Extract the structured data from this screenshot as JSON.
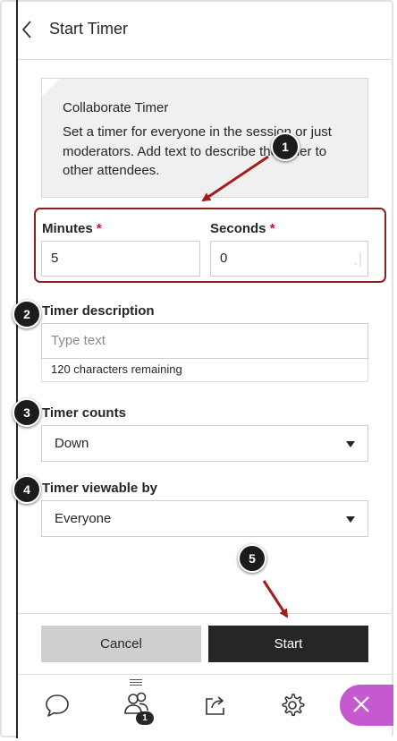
{
  "header": {
    "title": "Start Timer",
    "back_icon": "chevron-left-icon"
  },
  "info": {
    "title": "Collaborate Timer",
    "body": "Set a timer for everyone in the session or just moderators. Add text to describe the timer to other attendees."
  },
  "form": {
    "minutes": {
      "label": "Minutes",
      "required_mark": "*",
      "value": "5"
    },
    "seconds": {
      "label": "Seconds",
      "required_mark": "*",
      "value": "0"
    },
    "description": {
      "label": "Timer description",
      "placeholder": "Type text",
      "hint": "120 characters remaining"
    },
    "counts": {
      "label": "Timer counts",
      "value": "Down"
    },
    "viewable": {
      "label": "Timer viewable by",
      "value": "Everyone"
    }
  },
  "buttons": {
    "cancel": "Cancel",
    "start": "Start"
  },
  "dock": {
    "items": [
      "chat-icon",
      "attendees-icon",
      "share-content-icon",
      "settings-icon",
      "close-icon"
    ],
    "attendee_count": "1"
  },
  "callouts": [
    "1",
    "2",
    "3",
    "4",
    "5"
  ],
  "colors": {
    "callout_arrow": "#a31c1c",
    "required": "#c8102e",
    "close_fab": "#c55ad0",
    "start_button": "#262626"
  }
}
